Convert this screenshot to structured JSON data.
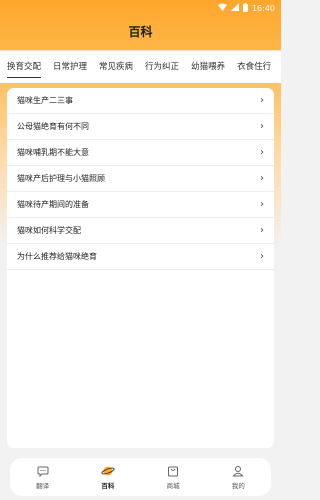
{
  "status": {
    "time": "16:40"
  },
  "header": {
    "title": "百科"
  },
  "tabs": [
    {
      "label": "换育交配",
      "active": true
    },
    {
      "label": "日常护理",
      "active": false
    },
    {
      "label": "常见疾病",
      "active": false
    },
    {
      "label": "行为纠正",
      "active": false
    },
    {
      "label": "幼猫喂养",
      "active": false
    },
    {
      "label": "衣食住行",
      "active": false
    }
  ],
  "articles": [
    {
      "title": "猫咪生产二三事"
    },
    {
      "title": "公母猫绝育有何不同"
    },
    {
      "title": "猫咪哺乳期不能大意"
    },
    {
      "title": "猫咪产后护理与小猫照顾"
    },
    {
      "title": "猫咪待产期间的准备"
    },
    {
      "title": "猫咪如何科学交配"
    },
    {
      "title": "为什么推荐给猫咪绝育"
    }
  ],
  "nav": [
    {
      "label": "翻译",
      "icon": "chat-icon",
      "active": false
    },
    {
      "label": "百科",
      "icon": "planet-icon",
      "active": true
    },
    {
      "label": "商城",
      "icon": "shop-icon",
      "active": false
    },
    {
      "label": "我的",
      "icon": "profile-icon",
      "active": false
    }
  ],
  "colors": {
    "accent": "#ffa62b",
    "background": "#f2f2f2"
  }
}
